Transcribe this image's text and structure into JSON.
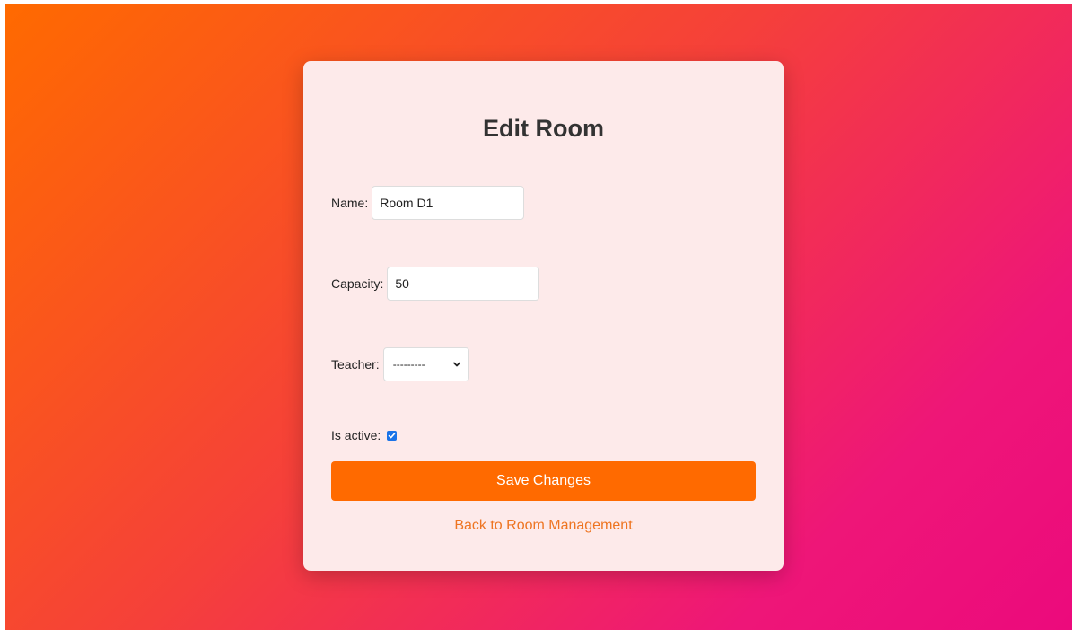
{
  "form": {
    "title": "Edit Room",
    "name_label": "Name:",
    "name_value": "Room D1",
    "capacity_label": "Capacity:",
    "capacity_value": "50",
    "teacher_label": "Teacher:",
    "teacher_selected": "---------",
    "active_label": "Is active:",
    "active_checked": true,
    "save_label": "Save Changes",
    "back_link": "Back to Room Management"
  },
  "colors": {
    "accent": "#ff6a00",
    "link": "#ee7522",
    "card_bg": "#fdeaea",
    "checkbox": "#1a73e8"
  },
  "icons": {
    "select_arrow": "chevron-down-icon",
    "checkbox_mark": "checkmark-icon"
  }
}
